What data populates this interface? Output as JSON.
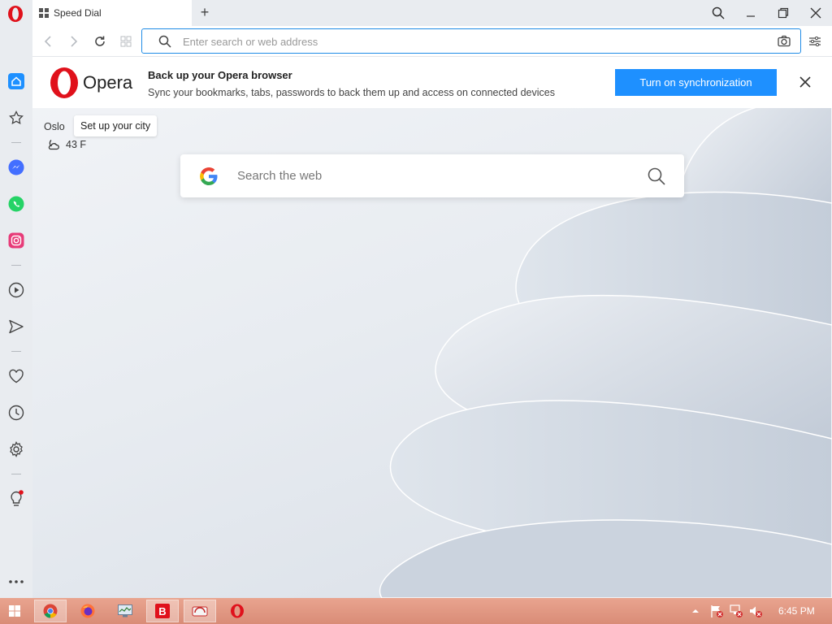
{
  "browser": {
    "tab_title": "Speed Dial",
    "new_tab_label": "+",
    "address_placeholder": "Enter search or web address"
  },
  "sidebar": {
    "items": [
      "home",
      "bookmarks",
      "messenger",
      "whatsapp",
      "instagram",
      "player",
      "flow",
      "favorites",
      "history",
      "settings",
      "tips",
      "more"
    ]
  },
  "banner": {
    "logo_text": "Opera",
    "title": "Back up your Opera browser",
    "subtitle": "Sync your bookmarks, tabs, passwords to back them up and access on connected devices",
    "button_label": "Turn on synchronization"
  },
  "weather": {
    "city": "Oslo",
    "tooltip": "Set up your city",
    "temperature": "43 F"
  },
  "search": {
    "placeholder": "Search the web"
  },
  "taskbar": {
    "apps": [
      "chrome",
      "firefox",
      "resource-monitor",
      "bitdefender",
      "disk-app",
      "opera"
    ],
    "clock": "6:45 PM"
  },
  "colors": {
    "accent": "#1e90ff",
    "opera_red": "#e0111b",
    "taskbar": "#e29a85"
  }
}
